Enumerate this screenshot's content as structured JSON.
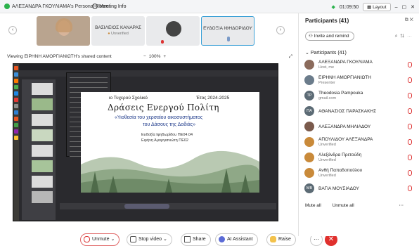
{
  "topbar": {
    "room_title": "ΑΛΕΞΑΝΔΡΑ ΓΚΟΥΛΙΑΜΑ's Personal Room",
    "meeting_info": "Meeting Info",
    "clock": "01:09:50",
    "layout_label": "Layout"
  },
  "videos": [
    {
      "name": "",
      "sub": ""
    },
    {
      "name": "ΒΑΣΙΛΕΙΟΣ ΚΑΝΑΡΑΣ",
      "sub": "Unverified"
    },
    {
      "name": "",
      "sub": ""
    },
    {
      "name": "ΕΥΔΟΞΙΑ ΙΦΗΔΟΡΙΔΟΥ",
      "sub": ""
    }
  ],
  "share": {
    "label": "Viewing ΕΙΡΗΝΗ ΑΜΟΡΓΙΑΝΙΩΤΗ's shared content",
    "zoom_minus": "−",
    "zoom": "100%",
    "zoom_plus": "+"
  },
  "slide": {
    "school": "ιο Τυχερού Σχολικό",
    "year": "Έτος 2024-2025",
    "title": "Δράσεις Ενεργού Πολίτη",
    "subtitle1": "«Υιοθεσία του χερσαίου οικοσυστήματος",
    "subtitle2": "του Δάσους της Δαδιάς»",
    "name1": "Ευδοξία Ιφηδωρίδου ΠΕ04.04",
    "name2": "Ειρήνη Αμοργιανιώτη ΠΕ02"
  },
  "toolbar": {
    "unmute": "Unmute",
    "stop_video": "Stop video",
    "share": "Share",
    "ai_assistant": "AI Assistant",
    "raise": "Raise"
  },
  "panel": {
    "title": "Participants (41)",
    "invite": "Invite and remind",
    "count_label": "Participants (41)",
    "participants": [
      {
        "initials": "",
        "name": "ΑΛΕΞΑΝΔΡΑ ΓΚΟΥΛΙΑΜΑ",
        "role": "Host, me",
        "color": "#8b6b5c"
      },
      {
        "initials": "",
        "name": "ΕΙΡΗΝΗ ΑΜΟΡΓΙΑΝΙΩΤΗ",
        "role": "Presenter",
        "color": "#6b7c8b"
      },
      {
        "initials": "TP",
        "name": "Theodosia Pampouka",
        "role": "gmail.com",
        "color": "#5c6b75"
      },
      {
        "initials": "ΠΑ",
        "name": "ΑΘΑΝΑΣΙΟΣ ΠΑΡΑΣΚΑΚΗΣ",
        "role": "",
        "color": "#5c6b75"
      },
      {
        "initials": "",
        "name": "ΑΛΕΞΑΝΔΡΑ ΜΗΛΙΑΔΟΥ",
        "role": "",
        "color": "#7a5a4c"
      },
      {
        "initials": "",
        "name": "ΑΠΟΥΛΙΔΟΥ ΑΛΕΞΑΝΔΡΑ",
        "role": "Unverified",
        "color": "#c98a3a"
      },
      {
        "initials": "",
        "name": "Αλεξάνδρα Πρετούδη",
        "role": "Unverified",
        "color": "#c98a3a"
      },
      {
        "initials": "",
        "name": "Ανθή Παπαδοπούλου",
        "role": "Unverified",
        "color": "#c98a3a"
      },
      {
        "initials": "ΜΒ",
        "name": "ΒΑΓΙΑ ΜΟΥΣΙΑΔΟΥ",
        "role": "",
        "color": "#5c6b75"
      }
    ],
    "mute_all": "Mute all",
    "unmute_all": "Unmute all"
  }
}
